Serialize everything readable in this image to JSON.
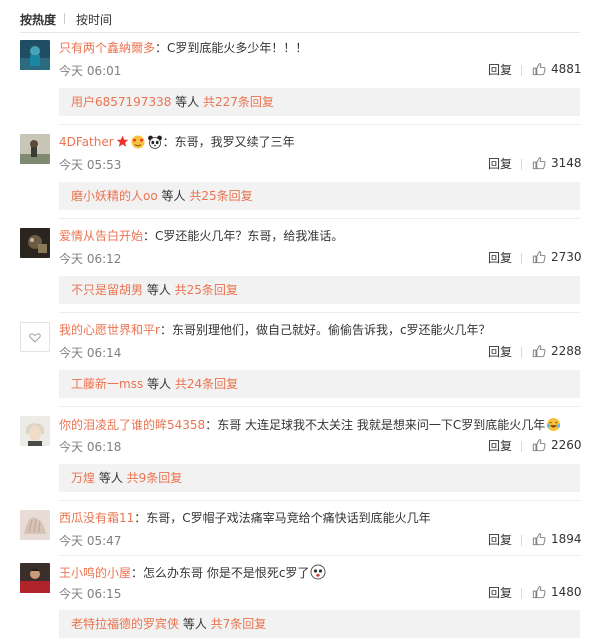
{
  "sort": {
    "hot_label": "按热度",
    "time_label": "按时间"
  },
  "reply_label": "回复",
  "comments": [
    {
      "user": "只有两个鑫納爾多",
      "text": "：C罗到底能火多少年！！！",
      "time": "今天 06:01",
      "likes": "4881",
      "replies": {
        "name": "用户6857197338",
        "mid": " 等人 ",
        "count": "共227条回复"
      }
    },
    {
      "user": "4DFather",
      "text": "：东哥，我罗又续了三年",
      "time": "今天 05:53",
      "likes": "3148",
      "replies": {
        "name": "磨小妖精的人oo",
        "mid": " 等人 ",
        "count": "共25条回复"
      }
    },
    {
      "user": "爱情从告白开始",
      "text": "：C罗还能火几年？东哥，给我准话。",
      "time": "今天 06:12",
      "likes": "2730",
      "replies": {
        "name": "不只是留胡男",
        "mid": " 等人 ",
        "count": "共25条回复"
      }
    },
    {
      "user": "我的心愿世界和平r",
      "text": "：东哥别理他们，做自己就好。偷偷告诉我，c罗还能火几年？",
      "time": "今天 06:14",
      "likes": "2288",
      "replies": {
        "name": "工藤新一mss",
        "mid": " 等人 ",
        "count": "共24条回复"
      }
    },
    {
      "user": "你的泪凌乱了谁的眸54358",
      "text": "：东哥 大连足球我不太关注 我就是想来问一下C罗到底能火几年",
      "time": "今天 06:18",
      "likes": "2260",
      "replies": {
        "name": "万煌",
        "mid": " 等人 ",
        "count": "共9条回复"
      }
    },
    {
      "user": "西瓜没有霜11",
      "text": "：东哥，C罗帽子戏法痛宰马竞给个痛快话到底能火几年",
      "time": "今天 05:47",
      "likes": "1894",
      "replies": null
    },
    {
      "user": "王小鸣的小屋",
      "text": "：怎么办东哥 你是不是恨死c罗了",
      "time": "今天 06:15",
      "likes": "1480",
      "replies": {
        "name": "老特拉福德的罗宾侠",
        "mid": " 等人 ",
        "count": "共7条回复"
      }
    }
  ],
  "colors": {
    "username": "#eb7350",
    "time": "#808080",
    "reply_bg": "#f2f2f2"
  },
  "icons": {
    "like": "thumbs-up-icon",
    "emoji": "laughing-tears-icon",
    "badges": [
      "star-badge-icon",
      "heart-eyes-badge-icon",
      "panda-badge-icon"
    ]
  }
}
